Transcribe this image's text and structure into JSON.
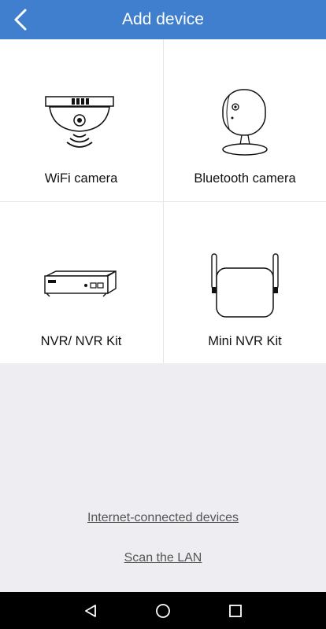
{
  "header": {
    "title": "Add device",
    "back_icon": "chevron-left-icon"
  },
  "devices": [
    {
      "label": "WiFi camera",
      "icon": "dome-camera-icon"
    },
    {
      "label": "Bluetooth camera",
      "icon": "cube-camera-icon"
    },
    {
      "label": "NVR/ NVR Kit",
      "icon": "nvr-recorder-icon"
    },
    {
      "label": "Mini NVR Kit",
      "icon": "mini-nvr-icon"
    }
  ],
  "links": {
    "internet_connected": "Internet-connected devices",
    "scan_lan": "Scan the LAN"
  },
  "navbar": {
    "back_icon": "triangle-back-icon",
    "home_icon": "circle-home-icon",
    "recents_icon": "square-recents-icon"
  },
  "colors": {
    "header": "#3f7fce",
    "background": "#eeeef2",
    "navbar": "#000000"
  }
}
